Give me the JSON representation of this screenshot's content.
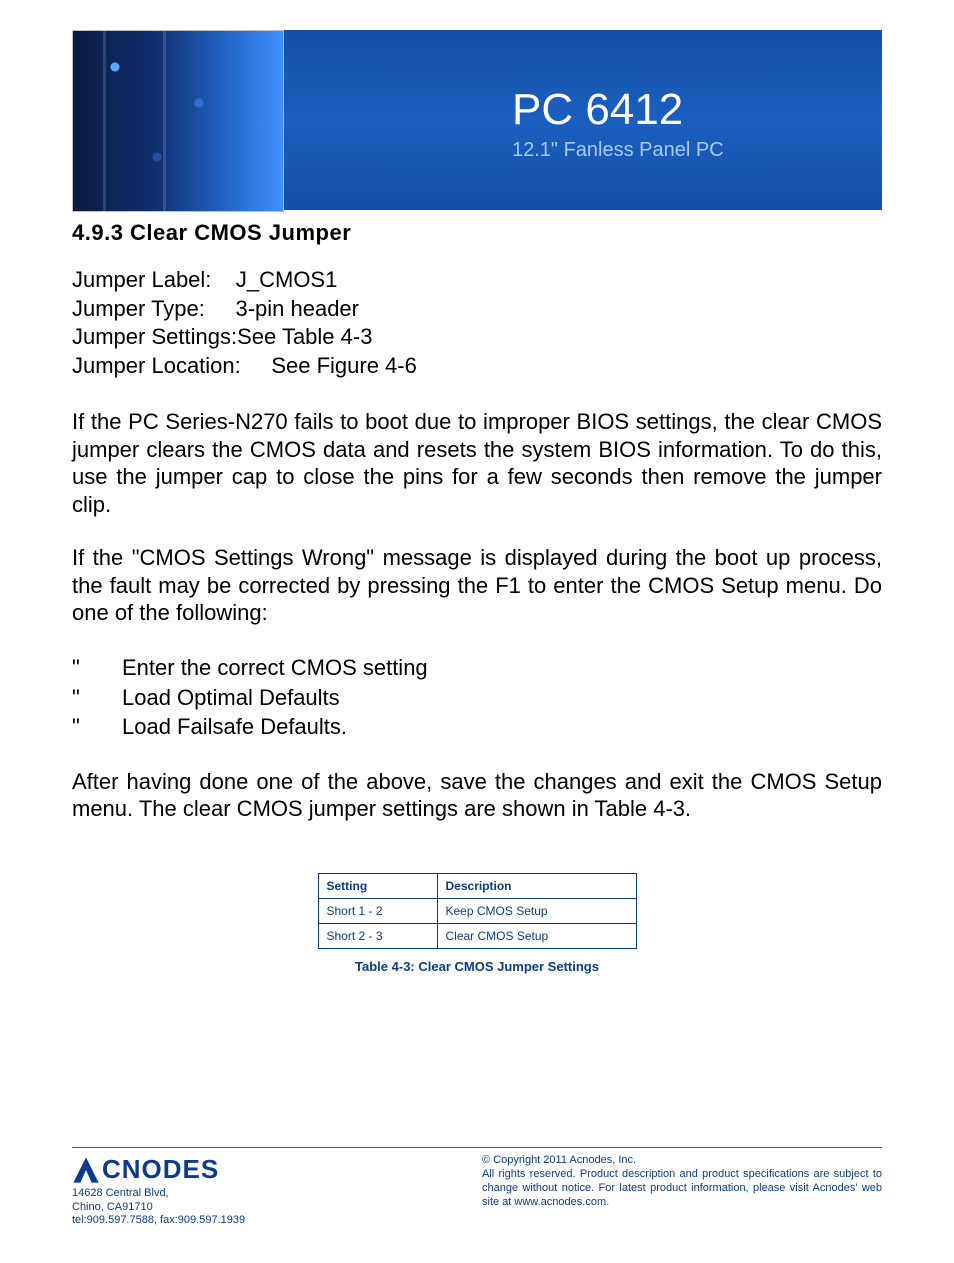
{
  "banner": {
    "title": "PC 6412",
    "subtitle": "12.1\" Fanless Panel PC"
  },
  "section": {
    "heading": "4.9.3 Clear CMOS Jumper"
  },
  "jumper": {
    "label_key": "Jumper Label:",
    "label_val": "J_CMOS1",
    "type_key": "Jumper Type:",
    "type_val": "3-pin header",
    "settings_key": "Jumper Settings:",
    "settings_val": "See Table 4-3",
    "location_key": "Jumper Location:",
    "location_val": "See Figure 4-6"
  },
  "paragraphs": {
    "p1": "If the PC Series-N270 fails to boot due to improper BIOS settings, the clear CMOS jumper clears the CMOS data and resets the system BIOS information. To do this, use the jumper cap to close the pins for a few seconds then remove the jumper clip.",
    "p2": "If the \"CMOS Settings Wrong\" message is displayed during the boot up process, the fault may be corrected by pressing the F1 to enter the CMOS Setup menu.  Do one of the following:",
    "p3": "After having done one of the above, save the changes and exit the CMOS Setup menu. The clear CMOS jumper settings are shown in Table 4-3."
  },
  "bullets": {
    "b1": "Enter the correct CMOS setting",
    "b2": "Load Optimal Defaults",
    "b3": "Load Failsafe Defaults.",
    "mark": "\""
  },
  "table": {
    "header_setting": "Setting",
    "header_desc": "Description",
    "rows": [
      {
        "setting": "Short 1 - 2",
        "desc": "Keep CMOS Setup"
      },
      {
        "setting": "Short 2 - 3",
        "desc": "Clear CMOS Setup"
      }
    ],
    "caption": "Table 4-3: Clear CMOS Jumper Settings"
  },
  "footer": {
    "logo_text": "CNODES",
    "addr1": "14628 Central Blvd,",
    "addr2": "Chino, CA91710",
    "tel": "tel:909.597.7588, fax:909.597.1939",
    "copy": "© Copyright 2011 Acnodes, Inc.",
    "legal": "All rights reserved. Product description and product specifications are subject to change without notice. For latest product information, please visit Acnodes' web site at www.acnodes.com."
  }
}
